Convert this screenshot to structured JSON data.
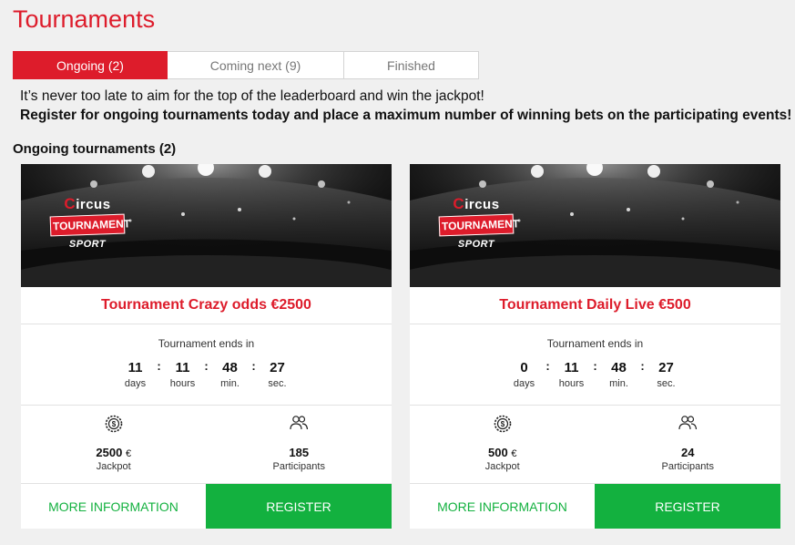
{
  "page": {
    "title": "Tournaments",
    "section_heading": "Ongoing tournaments (2)"
  },
  "tabs": [
    {
      "label": "Ongoing (2)",
      "active": true
    },
    {
      "label": "Coming next (9)",
      "active": false
    },
    {
      "label": "Finished",
      "active": false
    }
  ],
  "intro": {
    "line1": "It’s never too late to aim for the top of the leaderboard and win the jackpot!",
    "line2": "Register for ongoing tournaments today and place a maximum number of winning bets on the participating events!"
  },
  "banner": {
    "brand_c": "C",
    "brand_rest": "ircus",
    "badge": "TOURNAMENT",
    "sport": "SPORT"
  },
  "labels": {
    "ends_in": "Tournament ends in",
    "days": "days",
    "hours": "hours",
    "min": "min.",
    "sec": "sec.",
    "jackpot": "Jackpot",
    "participants": "Participants",
    "currency": "€",
    "more_info": "MORE INFORMATION",
    "register": "REGISTER",
    "separator": ":"
  },
  "tournaments": [
    {
      "name": "Tournament Crazy odds €2500",
      "days": "11",
      "hours": "11",
      "minutes": "48",
      "seconds": "27",
      "jackpot": "2500",
      "participants": "185"
    },
    {
      "name": "Tournament Daily Live €500",
      "days": "0",
      "hours": "11",
      "minutes": "48",
      "seconds": "27",
      "jackpot": "500",
      "participants": "24"
    }
  ],
  "colors": {
    "brand_red": "#dd1c2b",
    "green": "#13b13f",
    "background": "#f0f0f0"
  }
}
